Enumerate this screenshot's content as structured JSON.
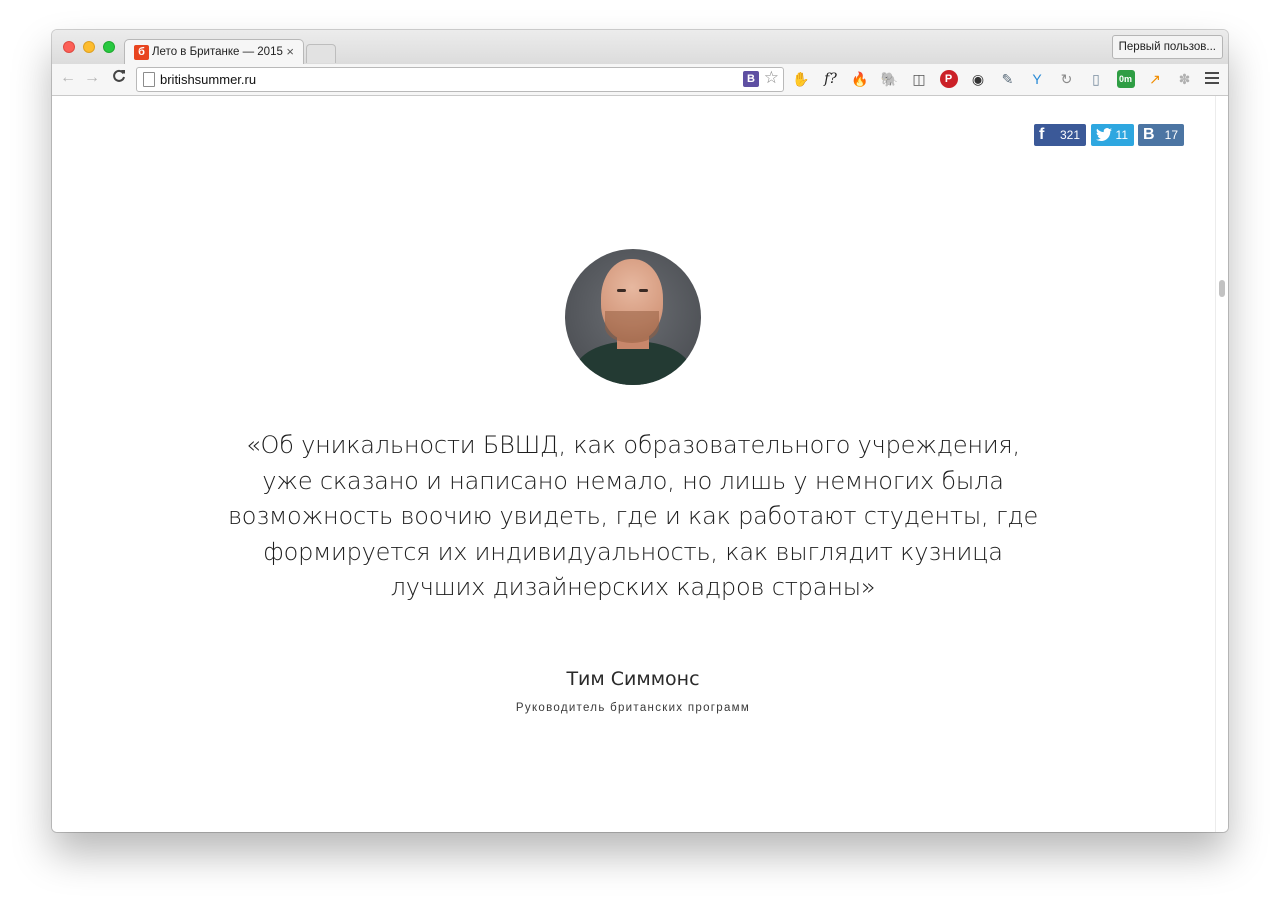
{
  "browser": {
    "tab": {
      "favicon_letter": "б",
      "title": "Лето в Британке — 2015",
      "close": "×"
    },
    "profile_label": "Первый пользов...",
    "nav": {
      "back": "←",
      "forward": "→",
      "reload": "C"
    },
    "url": "britishsummer.ru",
    "omnibox_badge": "B",
    "bookmark_star": "☆",
    "extensions": [
      {
        "name": "adblock-icon",
        "glyph": "✋",
        "color": "#d9342b"
      },
      {
        "name": "font-icon",
        "glyph": "f?",
        "color": "#222222"
      },
      {
        "name": "fire-icon",
        "glyph": "🔥",
        "color": "#e8701a"
      },
      {
        "name": "evernote-icon",
        "glyph": "🐘",
        "color": "#4a4a4a"
      },
      {
        "name": "pocket-icon",
        "glyph": "◫",
        "color": "#555555"
      },
      {
        "name": "pinterest-icon",
        "glyph": "P",
        "color": "#cb2027"
      },
      {
        "name": "camera-icon",
        "glyph": "◉",
        "color": "#333333"
      },
      {
        "name": "eyedropper-icon",
        "glyph": "✎",
        "color": "#5a6b7a"
      },
      {
        "name": "y-icon",
        "glyph": "Y",
        "color": "#2a8bd6"
      },
      {
        "name": "refresh-icon",
        "glyph": "↻",
        "color": "#8a8a8a"
      },
      {
        "name": "book-icon",
        "glyph": "▯",
        "color": "#7a8ea0"
      },
      {
        "name": "traffic-icon",
        "glyph": "0m",
        "color": "#2f9e44"
      },
      {
        "name": "chart-icon",
        "glyph": "↗",
        "color": "#f08c00"
      },
      {
        "name": "paw-icon",
        "glyph": "✽",
        "color": "#b0b0b0"
      }
    ]
  },
  "share": {
    "facebook": {
      "icon": "f",
      "count": "321"
    },
    "twitter": {
      "icon": "🐦",
      "count": "11"
    },
    "vk": {
      "icon": "B",
      "count": "17"
    }
  },
  "quote": {
    "lines": [
      "«Об уникальности БВШД, как образовательного учреждения,",
      "уже сказано и написано немало, но лишь у немногих была",
      "возможность воочию увидеть, где и как работают студенты, где",
      "формируется их индивидуальность, как выглядит кузница",
      "лучших дизайнерских кадров страны»"
    ]
  },
  "author": {
    "name": "Тим Симмонс",
    "role": "Руководитель британских программ"
  }
}
